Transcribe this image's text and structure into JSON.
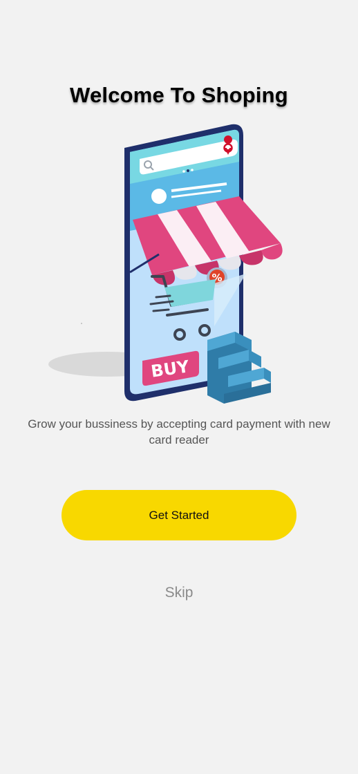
{
  "onboarding": {
    "title": "Welcome To Shoping",
    "subtitle": "Grow your bussiness by accepting card payment with new card reader",
    "primary_button_label": "Get Started",
    "skip_label": "Skip"
  },
  "illustration": {
    "buy_label": "BUY",
    "discount_symbol": "%",
    "icons": [
      "search-icon",
      "map-pin-icon",
      "shopping-cart-icon",
      "percent-icon"
    ]
  },
  "colors": {
    "background": "#f2f2f2",
    "accent": "#f8d800",
    "brand_pink": "#e0467f",
    "phone_frame": "#1f2f6b",
    "screen_blue": "#bfe0fb"
  }
}
